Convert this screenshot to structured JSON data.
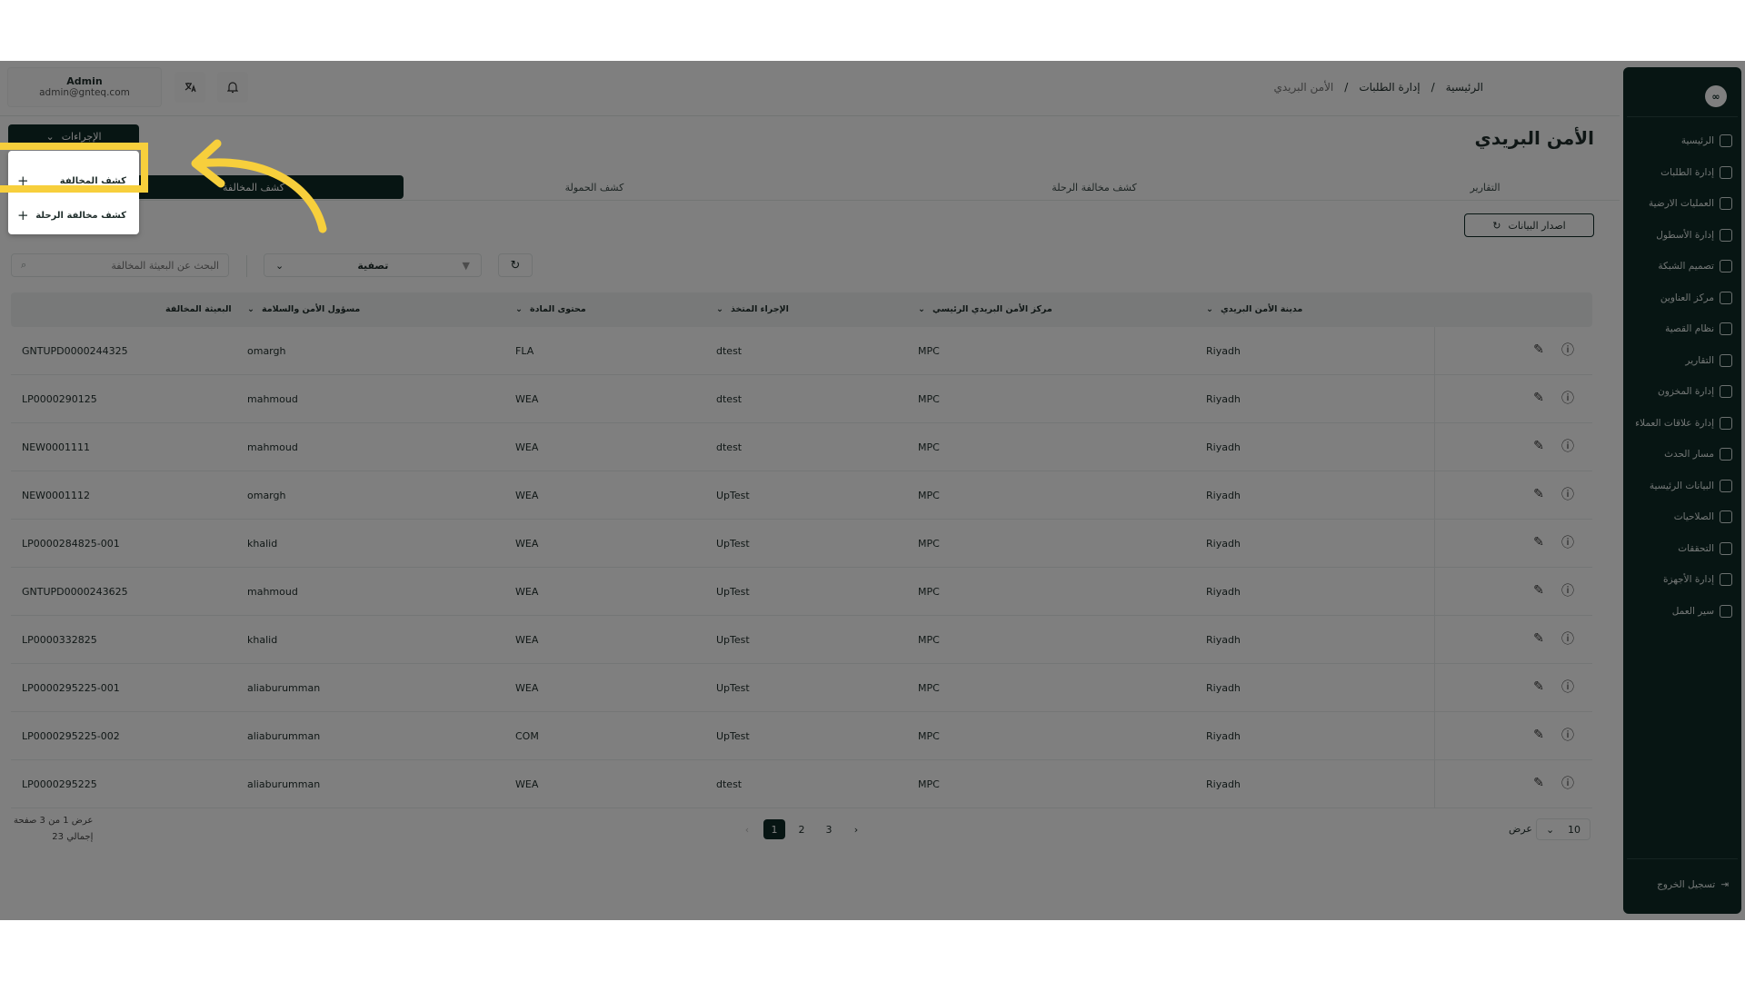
{
  "user": {
    "name": "Admin",
    "email": "admin@gnteq.com"
  },
  "breadcrumb": {
    "home": "الرئيسية",
    "section": "إدارة الطلبات",
    "current": "الأمن البريدي",
    "sep": "/"
  },
  "page_title": "الأمن البريدي",
  "actions_label": "الإجراءات",
  "actions_menu": [
    "كشف المخالفة",
    "كشف مخالفة الرحلة"
  ],
  "tabs": [
    "التقارير",
    "كشف مخالفة الرحلة",
    "كشف الحمولة",
    "كشف المخالفة"
  ],
  "export_label": "اصدار البيانات",
  "search_placeholder": "البحث عن البعيثة المخالفة",
  "filter_label": "تصفية",
  "columns": [
    "مدينة الأمن البريدي",
    "مركز الأمن البريدي الرئيسي",
    "الإجراء المتخذ",
    "محتوى المادة",
    "مسؤول الأمن والسلامة",
    "البعيثة المخالفة"
  ],
  "rows": [
    {
      "city": "Riyadh",
      "center": "MPC",
      "action": "dtest",
      "content": "FLA",
      "officer": "omargh",
      "item": "GNTUPD0000244325"
    },
    {
      "city": "Riyadh",
      "center": "MPC",
      "action": "dtest",
      "content": "WEA",
      "officer": "mahmoud",
      "item": "LP0000290125"
    },
    {
      "city": "Riyadh",
      "center": "MPC",
      "action": "dtest",
      "content": "WEA",
      "officer": "mahmoud",
      "item": "NEW0001111"
    },
    {
      "city": "Riyadh",
      "center": "MPC",
      "action": "UpTest",
      "content": "WEA",
      "officer": "omargh",
      "item": "NEW0001112"
    },
    {
      "city": "Riyadh",
      "center": "MPC",
      "action": "UpTest",
      "content": "WEA",
      "officer": "khalid",
      "item": "LP0000284825-001"
    },
    {
      "city": "Riyadh",
      "center": "MPC",
      "action": "UpTest",
      "content": "WEA",
      "officer": "mahmoud",
      "item": "GNTUPD0000243625"
    },
    {
      "city": "Riyadh",
      "center": "MPC",
      "action": "UpTest",
      "content": "WEA",
      "officer": "khalid",
      "item": "LP0000332825"
    },
    {
      "city": "Riyadh",
      "center": "MPC",
      "action": "UpTest",
      "content": "WEA",
      "officer": "aliaburumman",
      "item": "LP0000295225-001"
    },
    {
      "city": "Riyadh",
      "center": "MPC",
      "action": "UpTest",
      "content": "COM",
      "officer": "aliaburumman",
      "item": "LP0000295225-002"
    },
    {
      "city": "Riyadh",
      "center": "MPC",
      "action": "dtest",
      "content": "WEA",
      "officer": "aliaburumman",
      "item": "LP0000295225"
    }
  ],
  "pagination": {
    "info_line1": "عرض 1 من 3 صفحة",
    "info_line2": "إجمالي 23",
    "pages": [
      "1",
      "2",
      "3"
    ],
    "current": "1",
    "per_page_label": "عرض",
    "per_page": "10"
  },
  "sidebar": {
    "logo": "∞",
    "items": [
      "الرئيسية",
      "إدارة الطلبات",
      "العمليات الارضية",
      "إدارة الأسطول",
      "تصميم الشبكة",
      "مركز العناوين",
      "نظام القصية",
      "التقارير",
      "إدارة المخزون",
      "إدارة علاقات العملاء",
      "مسار الحدث",
      "البيانات الرئيسية",
      "الصلاحيات",
      "التحققات",
      "إدارة الأجهزة",
      "سير العمل"
    ],
    "logout": "تسجيل الخروج"
  },
  "colors": {
    "brand": "#0f2b27",
    "highlight": "#f7cf3c"
  }
}
